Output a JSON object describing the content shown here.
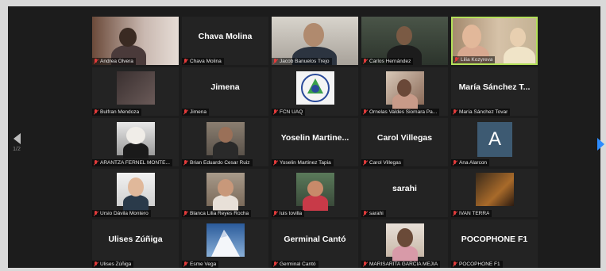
{
  "navigation": {
    "page_indicator": "1/2"
  },
  "tiles": [
    {
      "name": "Andrea Olvera",
      "type": "video"
    },
    {
      "name": "Chava Molina",
      "type": "name",
      "display": "Chava Molina"
    },
    {
      "name": "Jacob Banuelos Trejo",
      "type": "video"
    },
    {
      "name": "Carlos Hernández",
      "type": "video"
    },
    {
      "name": "Lilia Kozyreva",
      "type": "video",
      "active": true
    },
    {
      "name": "Bulfran Mendoza",
      "type": "photo"
    },
    {
      "name": "Jimena",
      "type": "name",
      "display": "Jimena"
    },
    {
      "name": "FCN UAQ",
      "type": "photo"
    },
    {
      "name": "Ornelas Valdes Siomara Pa...",
      "type": "photo"
    },
    {
      "name": "María Sánchez Tovar",
      "type": "name",
      "display": "María Sánchez T..."
    },
    {
      "name": "ARANTZA FERNEL MONTE...",
      "type": "photo"
    },
    {
      "name": "Brian Eduardo Cesar Ruiz",
      "type": "photo"
    },
    {
      "name": "Yoselin Martinez Tapia",
      "type": "name",
      "display": "Yoselin Martine..."
    },
    {
      "name": "Carol Villegas",
      "type": "name",
      "display": "Carol Villegas"
    },
    {
      "name": "Ana Alarcon",
      "type": "letter",
      "letter": "A"
    },
    {
      "name": "Ursio Dávila Montero",
      "type": "photo"
    },
    {
      "name": "Blanca Lilia Reyes Rocha",
      "type": "photo"
    },
    {
      "name": "luis tovilla",
      "type": "photo"
    },
    {
      "name": "sarahi",
      "type": "name",
      "display": "sarahi"
    },
    {
      "name": "IVAN TERRA",
      "type": "photo"
    },
    {
      "name": "Ulises Zúñiga",
      "type": "name",
      "display": "Ulises Zúñiga"
    },
    {
      "name": "Esme Vega",
      "type": "photo"
    },
    {
      "name": "Germinal Cantó",
      "type": "name",
      "display": "Germinal Cantó"
    },
    {
      "name": "MARISARITA GARCIA MEJIA",
      "type": "photo"
    },
    {
      "name": "POCOPHONE F1",
      "type": "name",
      "display": "POCOPHONE F1"
    }
  ],
  "colors": {
    "active_speaker_border": "#b4e05a",
    "next_arrow": "#2d8cff",
    "muted_mic": "#e23b3b"
  }
}
